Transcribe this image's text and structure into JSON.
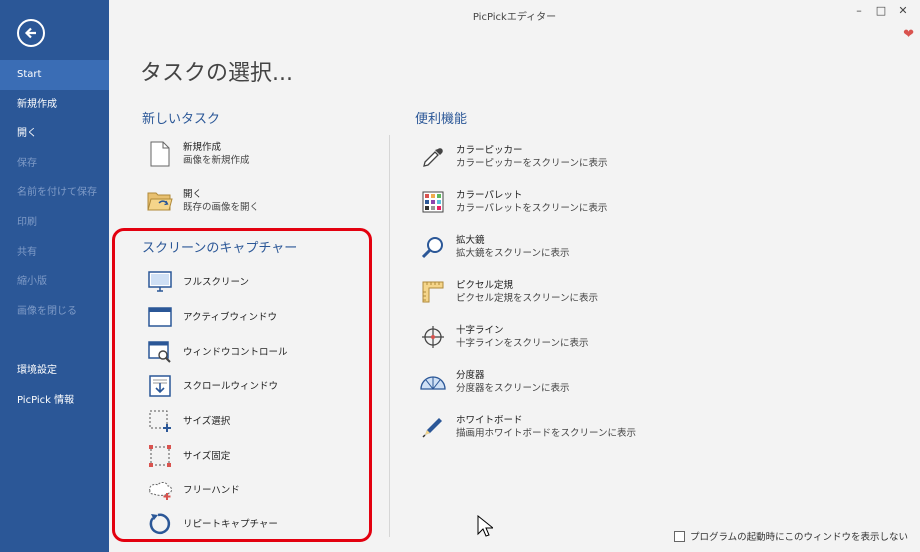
{
  "window": {
    "title": "PicPickエディター"
  },
  "sidebar": {
    "items": [
      {
        "label": "Start",
        "state": "active"
      },
      {
        "label": "新規作成",
        "state": "enabled"
      },
      {
        "label": "開く",
        "state": "enabled"
      },
      {
        "label": "保存",
        "state": "disabled"
      },
      {
        "label": "名前を付けて保存",
        "state": "disabled"
      },
      {
        "label": "印刷",
        "state": "disabled"
      },
      {
        "label": "共有",
        "state": "disabled"
      },
      {
        "label": "縮小版",
        "state": "disabled"
      },
      {
        "label": "画像を閉じる",
        "state": "disabled"
      },
      {
        "label": "環境設定",
        "state": "enabled"
      },
      {
        "label": "PicPick 情報",
        "state": "enabled"
      }
    ]
  },
  "main": {
    "page_title": "タスクの選択...",
    "new_task": {
      "heading": "新しいタスク",
      "items": [
        {
          "title": "新規作成",
          "desc": "画像を新規作成"
        },
        {
          "title": "開く",
          "desc": "既存の画像を開く"
        }
      ]
    },
    "capture": {
      "heading": "スクリーンのキャプチャー",
      "items": [
        {
          "label": "フルスクリーン"
        },
        {
          "label": "アクティブウィンドウ"
        },
        {
          "label": "ウィンドウコントロール"
        },
        {
          "label": "スクロールウィンドウ"
        },
        {
          "label": "サイズ選択"
        },
        {
          "label": "サイズ固定"
        },
        {
          "label": "フリーハンド"
        },
        {
          "label": "リピートキャプチャー"
        }
      ]
    },
    "tools": {
      "heading": "便利機能",
      "items": [
        {
          "title": "カラーピッカー",
          "desc": "カラーピッカーをスクリーンに表示"
        },
        {
          "title": "カラーパレット",
          "desc": "カラーパレットをスクリーンに表示"
        },
        {
          "title": "拡大鏡",
          "desc": "拡大鏡をスクリーンに表示"
        },
        {
          "title": "ピクセル定規",
          "desc": "ピクセル定規をスクリーンに表示"
        },
        {
          "title": "十字ライン",
          "desc": "十字ラインをスクリーンに表示"
        },
        {
          "title": "分度器",
          "desc": "分度器をスクリーンに表示"
        },
        {
          "title": "ホワイトボード",
          "desc": "描画用ホワイトボードをスクリーンに表示"
        }
      ]
    },
    "startup_checkbox": {
      "label": "プログラムの起動時にこのウィンドウを表示しない",
      "checked": false
    }
  },
  "colors": {
    "sidebar": "#2b5797",
    "accent": "#2b5797",
    "highlight": "#e3000f"
  }
}
